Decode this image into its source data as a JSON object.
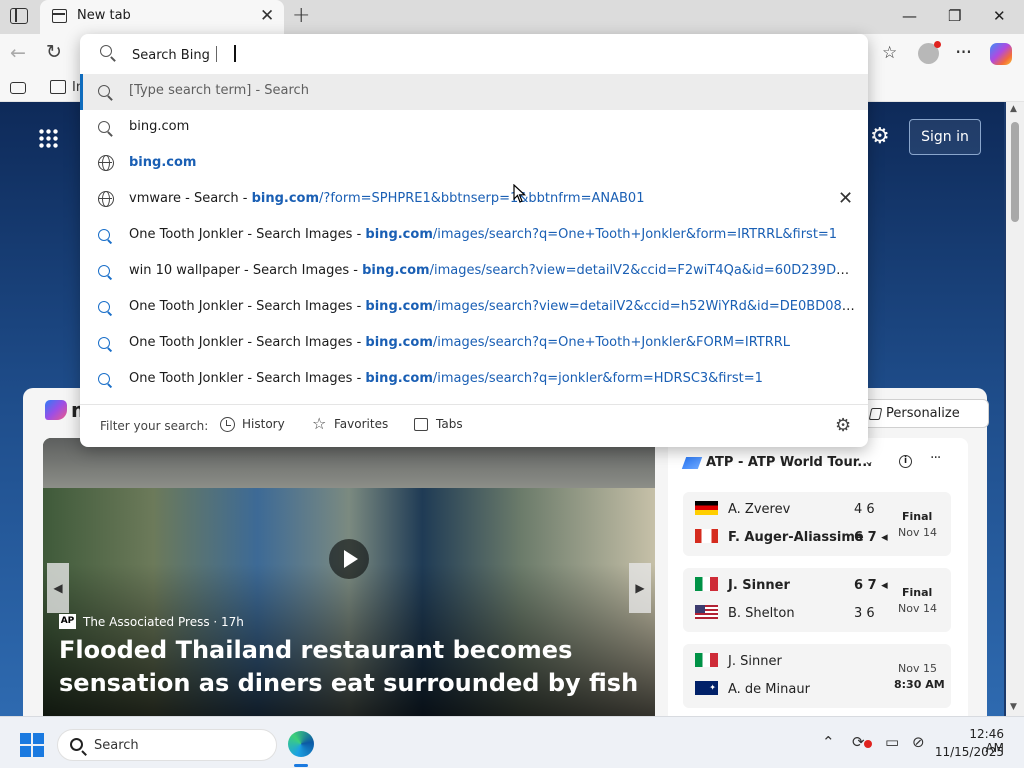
{
  "tab": {
    "title": "New tab"
  },
  "favorites_bar": {
    "first_label": "In"
  },
  "omnibox": {
    "placeholder": "Search Bing",
    "suggestions": [
      {
        "text": "[Type search term] - Search"
      },
      {
        "text": "bing.com"
      },
      {
        "text": "bing.com"
      },
      {
        "prefix": "vmware - Search - ",
        "domain": "bing.com",
        "path": "/?form=SPHPRE1&bbtnserp=1&bbtnfrm=ANAB01"
      },
      {
        "prefix": "One Tooth Jonkler - Search Images - ",
        "domain": "bing.com",
        "path": "/images/search?q=One+Tooth+Jonkler&form=IRTRRL&first=1"
      },
      {
        "prefix": "win 10 wallpaper - Search Images - ",
        "domain": "bing.com",
        "path": "/images/search?view=detailV2&ccid=F2wiT4Qa&id=60D239D3B863A..."
      },
      {
        "prefix": "One Tooth Jonkler - Search Images - ",
        "domain": "bing.com",
        "path": "/images/search?view=detailV2&ccid=h52WiYRd&id=DE0BD0842DBE..."
      },
      {
        "prefix": "One Tooth Jonkler - Search Images - ",
        "domain": "bing.com",
        "path": "/images/search?q=One+Tooth+Jonkler&FORM=IRTRRL"
      },
      {
        "prefix": "One Tooth Jonkler - Search Images - ",
        "domain": "bing.com",
        "path": "/images/search?q=jonkler&form=HDRSC3&first=1"
      }
    ],
    "filter": {
      "label": "Filter your search:",
      "history": "History",
      "favorites": "Favorites",
      "tabs": "Tabs"
    }
  },
  "page": {
    "sign_in": "Sign in",
    "msn_letter": "m",
    "personalize": "Personalize",
    "hero": {
      "source": "The Associated Press · 17h",
      "source_logo": "AP",
      "headline": "Flooded Thailand restaurant becomes sensation as diners eat surrounded by fish"
    },
    "sports": {
      "title": "ATP - ATP World Tour...",
      "matches": [
        {
          "p1": "A. Zverev",
          "s1": "4 6",
          "p2": "F. Auger-Aliassime",
          "s2": "6 7",
          "status": "Final",
          "date": "Nov 14"
        },
        {
          "p1": "J. Sinner",
          "s1": "6 7",
          "p2": "B. Shelton",
          "s2": "3 6",
          "status": "Final",
          "date": "Nov 14"
        },
        {
          "p1": "J. Sinner",
          "p2": "A. de Minaur",
          "date": "Nov 15",
          "time": "8:30 AM"
        }
      ]
    }
  },
  "taskbar": {
    "search": "Search",
    "time": "12:46 AM",
    "date": "11/15/2025"
  },
  "colors": {
    "accent": "#0f6cbd",
    "link": "#1a5fb4"
  }
}
